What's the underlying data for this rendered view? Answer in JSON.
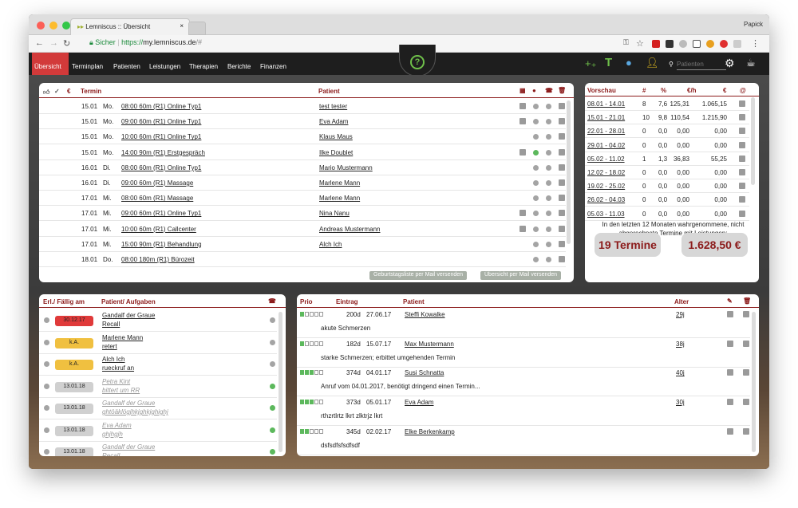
{
  "browser": {
    "tab_title": "Lemniscus :: Übersicht",
    "profile": "Papick",
    "secure_label": "Sicher",
    "url_prefix": "https://",
    "url_host": "my.lemniscus.de",
    "url_path": "/#"
  },
  "nav": {
    "items": [
      "Übersicht",
      "Terminplan",
      "Patienten",
      "Leistungen",
      "Therapien",
      "Berichte",
      "Finanzen"
    ],
    "search_placeholder": "Patienten"
  },
  "appointments": {
    "header_termin": "Termin",
    "header_patient": "Patient",
    "rows": [
      {
        "date": "15.01",
        "day": "Mo.",
        "desc": "08:00 60m (R1) Online Typ1",
        "patient": "test tester",
        "sq": true,
        "bubble": "grey"
      },
      {
        "date": "15.01",
        "day": "Mo.",
        "desc": "09:00 60m (R1) Online Typ1",
        "patient": "Eva Adam",
        "sq": true,
        "bubble": "grey"
      },
      {
        "date": "15.01",
        "day": "Mo.",
        "desc": "10:00 60m (R1) Online Typ1",
        "patient": "Klaus Maus",
        "sq": false,
        "bubble": "grey"
      },
      {
        "date": "15.01",
        "day": "Mo.",
        "desc": "14:00 90m (R1) Erstgespräch",
        "patient": "Ilke Doublet",
        "sq": true,
        "bubble": "green"
      },
      {
        "date": "16.01",
        "day": "Di.",
        "desc": "08:00 60m (R1) Online Typ1",
        "patient": "Mario Mustermann",
        "sq": false,
        "bubble": "grey"
      },
      {
        "date": "16.01",
        "day": "Di.",
        "desc": "09:00 60m (R1) Massage",
        "patient": "Marlene Mann",
        "sq": false,
        "bubble": "grey"
      },
      {
        "date": "17.01",
        "day": "Mi.",
        "desc": "08:00 60m (R1) Massage",
        "patient": "Marlene Mann",
        "sq": false,
        "bubble": "grey"
      },
      {
        "date": "17.01",
        "day": "Mi.",
        "desc": "09:00 60m (R1) Online Typ1",
        "patient": "Nina Nanu",
        "sq": true,
        "bubble": "grey"
      },
      {
        "date": "17.01",
        "day": "Mi.",
        "desc": "10:00 60m (R1) Callcenter",
        "patient": "Andreas Mustermann",
        "sq": true,
        "bubble": "grey"
      },
      {
        "date": "17.01",
        "day": "Mi.",
        "desc": "15:00 90m (R1) Behandlung",
        "patient": "Alch Ich",
        "sq": false,
        "bubble": "grey"
      },
      {
        "date": "18.01",
        "day": "Do.",
        "desc": "08:00 180m (R1) Bürozeit",
        "patient": "",
        "sq": false,
        "bubble": "grey"
      }
    ],
    "btn_birthday": "Geburtstagsliste per Mail versenden",
    "btn_overview": "Übersicht per Mail versenden"
  },
  "forecast": {
    "headers": [
      "Vorschau",
      "#",
      "%",
      "€/h",
      "€",
      "@"
    ],
    "rows": [
      [
        "08.01 - 14.01",
        "8",
        "7,6",
        "125,31",
        "1.065,15"
      ],
      [
        "15.01 - 21.01",
        "10",
        "9,8",
        "110,54",
        "1.215,90"
      ],
      [
        "22.01 - 28.01",
        "0",
        "0,0",
        "0,00",
        "0,00"
      ],
      [
        "29.01 - 04.02",
        "0",
        "0,0",
        "0,00",
        "0,00"
      ],
      [
        "05.02 - 11.02",
        "1",
        "1,3",
        "36,83",
        "55,25"
      ],
      [
        "12.02 - 18.02",
        "0",
        "0,0",
        "0,00",
        "0,00"
      ],
      [
        "19.02 - 25.02",
        "0",
        "0,0",
        "0,00",
        "0,00"
      ],
      [
        "26.02 - 04.03",
        "0",
        "0,0",
        "0,00",
        "0,00"
      ],
      [
        "05.03 - 11.03",
        "0",
        "0,0",
        "0,00",
        "0,00"
      ]
    ],
    "note": "In den letzten 12 Monaten wahrgenommene, nicht abgerechnete Termine mit Leistungen:",
    "termine": "19 Termine",
    "amount": "1.628,50 €"
  },
  "tasks": {
    "header_due": "Erl./ Fällig am",
    "header_patient": "Patient/ Aufgaben",
    "rows": [
      {
        "due": "30.12.17",
        "bg": "#e03a3a",
        "fg": "#222",
        "name": "Gandalf der Graue",
        "task": "Recall",
        "done": false,
        "green": false
      },
      {
        "due": "k.A.",
        "bg": "#f0c040",
        "fg": "#222",
        "name": "Marlene Mann",
        "task": "retert",
        "done": false,
        "green": false
      },
      {
        "due": "k.A.",
        "bg": "#f0c040",
        "fg": "#222",
        "name": "Alch Ich",
        "task": "rueckruf an",
        "done": false,
        "green": false
      },
      {
        "due": "13.01.18",
        "bg": "#d0d0d0",
        "fg": "#222",
        "name": "Petra Kint",
        "task": "bittert um RR",
        "done": true,
        "green": true
      },
      {
        "due": "13.01.18",
        "bg": "#d0d0d0",
        "fg": "#222",
        "name": "Gandalf der Graue",
        "task": "ghtöäklögjhkjghkjghighj",
        "done": true,
        "green": true
      },
      {
        "due": "13.01.18",
        "bg": "#d0d0d0",
        "fg": "#222",
        "name": "Eva Adam",
        "task": "ghjhgjh",
        "done": true,
        "green": true
      },
      {
        "due": "13.01.18",
        "bg": "#d0d0d0",
        "fg": "#222",
        "name": "Gandalf der Graue",
        "task": "Recall",
        "done": true,
        "green": true
      }
    ]
  },
  "waitlist": {
    "headers": {
      "prio": "Prio",
      "entry": "Eintrag",
      "patient": "Patient",
      "age": "Alter"
    },
    "rows": [
      {
        "prio": 1,
        "days": "200d",
        "date": "27.06.17",
        "patient": "Steffi Kowalke",
        "age": "29j",
        "note": "akute Schmerzen"
      },
      {
        "prio": 1,
        "days": "182d",
        "date": "15.07.17",
        "patient": "Max Mustermann",
        "age": "38j",
        "note": "starke Schmerzen; erbittet umgehenden Termin"
      },
      {
        "prio": 3,
        "days": "374d",
        "date": "04.01.17",
        "patient": "Susi Schnatta",
        "age": "40j",
        "note": "Anruf vom 04.01.2017, benötigt dringend einen Termin..."
      },
      {
        "prio": 3,
        "days": "373d",
        "date": "05.01.17",
        "patient": "Eva Adam",
        "age": "30j",
        "note": "rthzrtlrtz lkrt zlktrjz lkrt"
      },
      {
        "prio": 2,
        "days": "345d",
        "date": "02.02.17",
        "patient": "Elke Berkenkamp",
        "age": "",
        "note": "dsfsdfsfsdfsdf"
      }
    ]
  },
  "colors": {
    "accent": "#d23a3a",
    "header_red": "#8b1a1a",
    "green": "#5cb85c"
  }
}
